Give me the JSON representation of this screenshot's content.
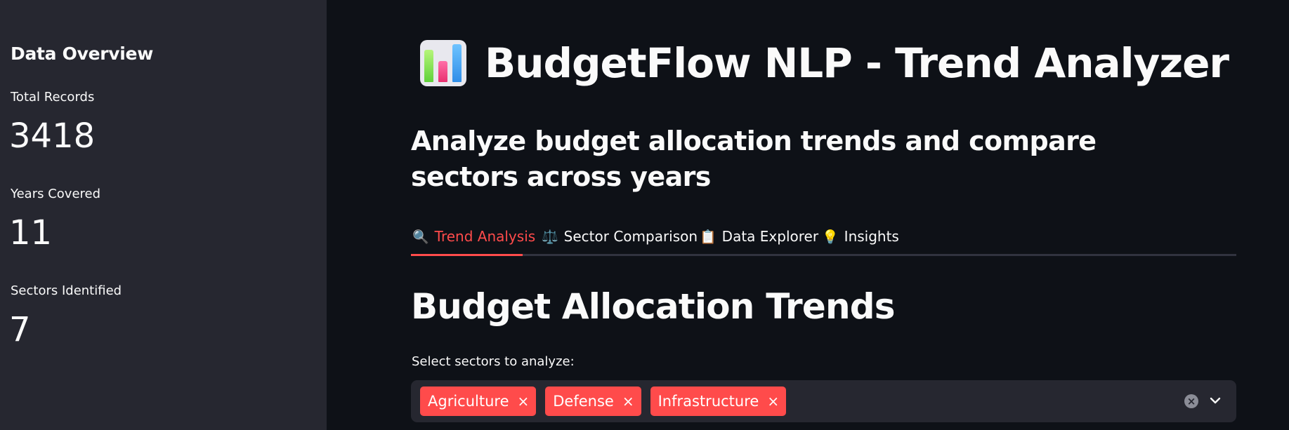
{
  "sidebar": {
    "heading": "Data Overview",
    "metrics": [
      {
        "label": "Total Records",
        "value": "3418"
      },
      {
        "label": "Years Covered",
        "value": "11"
      },
      {
        "label": "Sectors Identified",
        "value": "7"
      }
    ]
  },
  "header": {
    "icon": "bar-chart-icon",
    "title": "BudgetFlow NLP - Trend Analyzer",
    "subtitle": "Analyze budget allocation trends and compare sectors across years"
  },
  "tabs": [
    {
      "icon": "🔍",
      "icon_name": "magnifier-icon",
      "label": "Trend Analysis",
      "active": true
    },
    {
      "icon": "⚖️",
      "icon_name": "balance-scale-icon",
      "label": "Sector Comparison",
      "active": false
    },
    {
      "icon": "📋",
      "icon_name": "clipboard-icon",
      "label": "Data Explorer",
      "active": false
    },
    {
      "icon": "💡",
      "icon_name": "lightbulb-icon",
      "label": "Insights",
      "active": false
    }
  ],
  "section": {
    "title": "Budget Allocation Trends",
    "select_label": "Select sectors to analyze:",
    "selected": [
      "Agriculture",
      "Defense",
      "Infrastructure"
    ],
    "chip_remove": "×",
    "clear_symbol": "×"
  },
  "colors": {
    "accent": "#ff4b4b",
    "background": "#0e1117",
    "sidebar": "#262730"
  }
}
